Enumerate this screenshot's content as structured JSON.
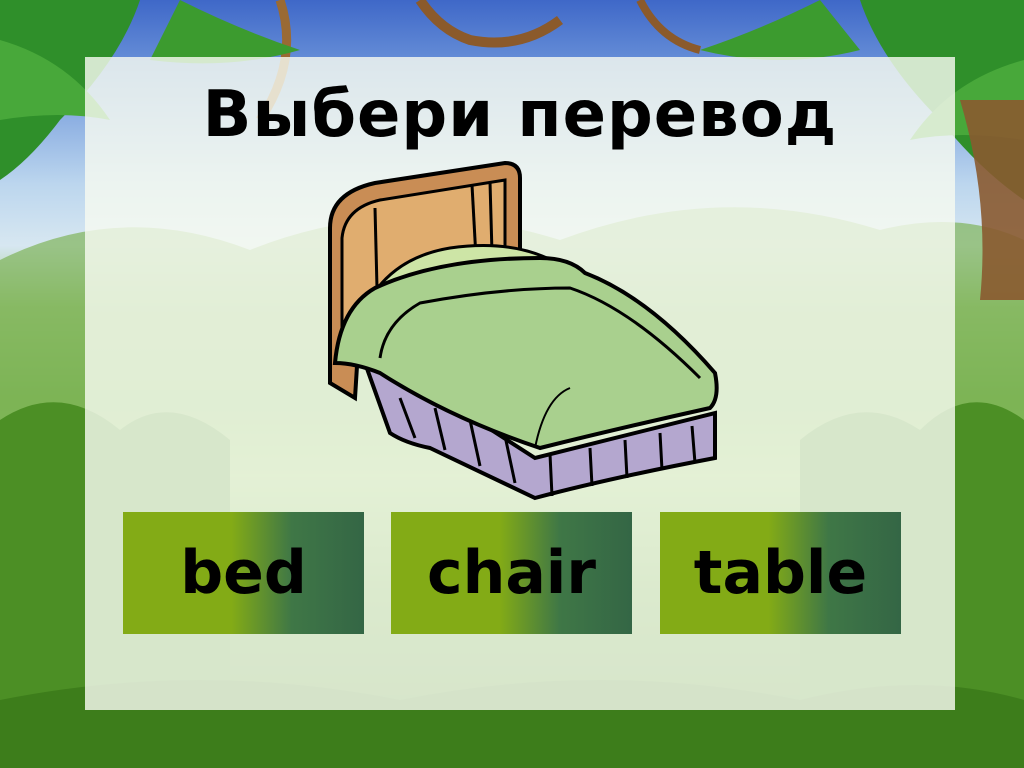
{
  "prompt": {
    "title": "Выбери перевод"
  },
  "picture": {
    "icon": "bed-icon"
  },
  "choices": [
    {
      "label": "bed"
    },
    {
      "label": "chair"
    },
    {
      "label": "table"
    }
  ],
  "colors": {
    "button_left": "#83ab16",
    "button_right": "#346645",
    "panel": "#f7faf0"
  }
}
